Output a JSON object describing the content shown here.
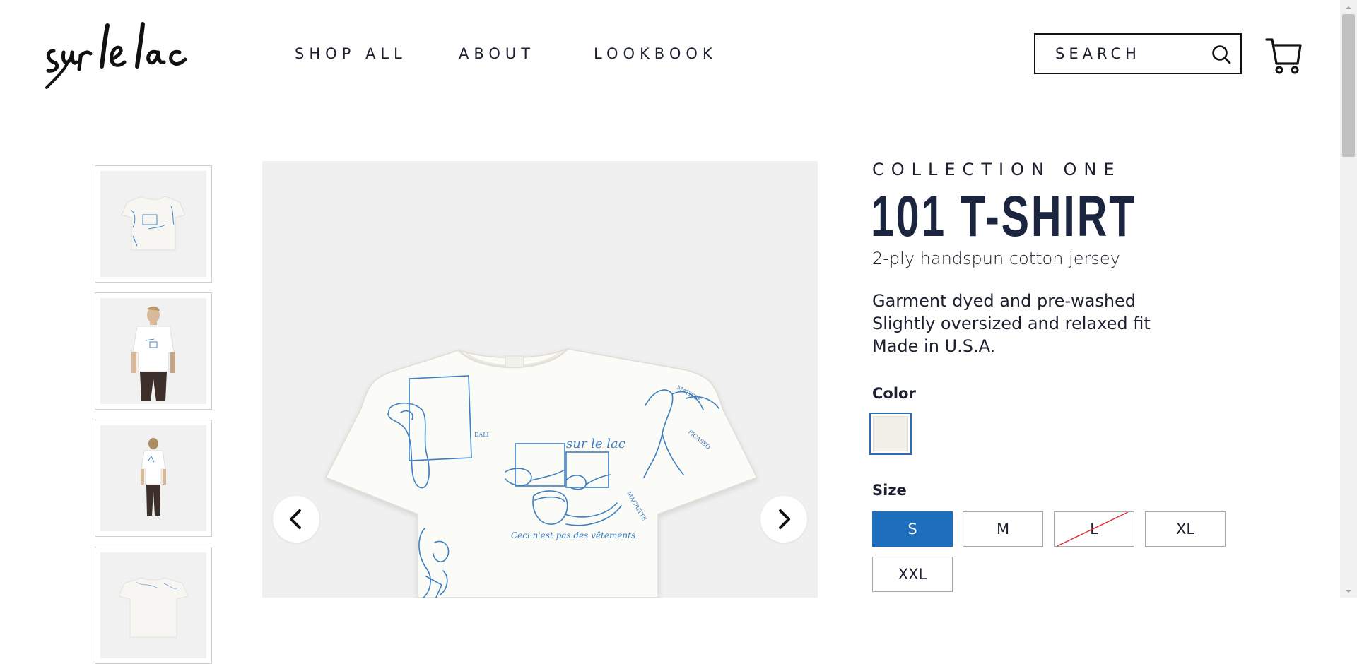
{
  "header": {
    "logo_text": "sur le lac",
    "nav": [
      {
        "label": "SHOP ALL"
      },
      {
        "label": "ABOUT"
      },
      {
        "label": "LOOKBOOK"
      }
    ],
    "search_placeholder": "SEARCH",
    "search_icon": "search-icon",
    "cart_icon": "cart-icon"
  },
  "gallery": {
    "thumbnails": [
      {
        "name": "thumb-front-flat"
      },
      {
        "name": "thumb-model-front"
      },
      {
        "name": "thumb-model-back"
      },
      {
        "name": "thumb-back-flat"
      }
    ],
    "prev_icon": "chevron-left-icon",
    "next_icon": "chevron-right-icon",
    "shirt_print_text": "Ceci n'est pas des vêtements",
    "shirt_logo_text": "sur le lac"
  },
  "product": {
    "collection": "COLLECTION ONE",
    "title": "101 T-SHIRT",
    "subtitle": "2-ply handspun cotton jersey",
    "description": [
      "Garment dyed and pre-washed",
      "Slightly oversized and relaxed fit",
      "Made in U.S.A."
    ],
    "color_label": "Color",
    "color_swatch": "#f2efe8",
    "size_label": "Size",
    "sizes": [
      {
        "label": "S",
        "state": "selected"
      },
      {
        "label": "M",
        "state": "available"
      },
      {
        "label": "L",
        "state": "sold-out"
      },
      {
        "label": "XL",
        "state": "available"
      },
      {
        "label": "XXL",
        "state": "available"
      }
    ]
  },
  "colors": {
    "accent": "#1d6fbd",
    "text": "#1c2030",
    "sold_out_slash": "#e0303a"
  }
}
